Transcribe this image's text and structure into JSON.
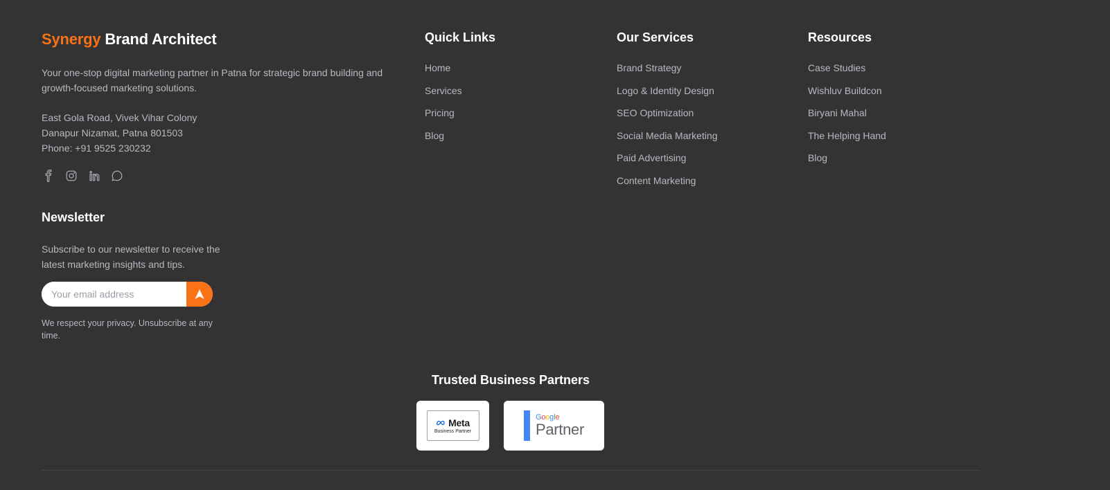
{
  "brand": {
    "accent": "Synergy",
    "rest": " Brand Architect",
    "accent_color": "#f97316"
  },
  "about": "Your one-stop digital marketing partner in Patna for strategic brand building and growth-focused marketing solutions.",
  "address": {
    "line1": "East Gola Road, Vivek Vihar Colony",
    "line2": "Danapur Nizamat, Patna 801503",
    "phone": "Phone: +91 9525 230232"
  },
  "socials": [
    "facebook-icon",
    "instagram-icon",
    "linkedin-icon",
    "whatsapp-icon"
  ],
  "newsletter": {
    "title": "Newsletter",
    "text": "Subscribe to our newsletter to receive the latest marketing insights and tips.",
    "placeholder": "Your email address",
    "note": "We respect your privacy. Unsubscribe at any time."
  },
  "quick_links": {
    "title": "Quick Links",
    "items": [
      "Home",
      "Services",
      "Pricing",
      "Blog"
    ]
  },
  "services": {
    "title": "Our Services",
    "items": [
      "Brand Strategy",
      "Logo & Identity Design",
      "SEO Optimization",
      "Social Media Marketing",
      "Paid Advertising",
      "Content Marketing"
    ]
  },
  "resources": {
    "title": "Resources",
    "items": [
      "Case Studies",
      "Wishluv Buildcon",
      "Biryani Mahal",
      "The Helping Hand",
      "Blog"
    ]
  },
  "partners": {
    "title": "Trusted Business Partners",
    "meta": {
      "word": "Meta",
      "sub": "Business Partner"
    },
    "google": {
      "word": "Google",
      "partner": "Partner"
    }
  }
}
